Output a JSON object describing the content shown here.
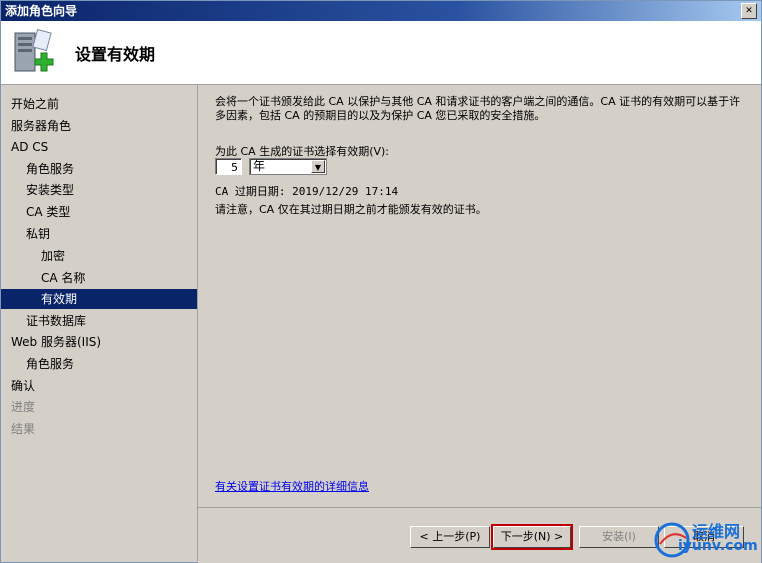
{
  "window": {
    "title": "添加角色向导"
  },
  "header": {
    "title": "设置有效期",
    "icon": "server-add-role-icon"
  },
  "sidebar": {
    "items": [
      {
        "label": "开始之前",
        "level": 1,
        "state": "normal"
      },
      {
        "label": "服务器角色",
        "level": 1,
        "state": "normal"
      },
      {
        "label": "AD CS",
        "level": 1,
        "state": "normal"
      },
      {
        "label": "角色服务",
        "level": 2,
        "state": "normal"
      },
      {
        "label": "安装类型",
        "level": 2,
        "state": "normal"
      },
      {
        "label": "CA 类型",
        "level": 2,
        "state": "normal"
      },
      {
        "label": "私钥",
        "level": 2,
        "state": "normal"
      },
      {
        "label": "加密",
        "level": 3,
        "state": "normal"
      },
      {
        "label": "CA 名称",
        "level": 3,
        "state": "normal"
      },
      {
        "label": "有效期",
        "level": 3,
        "state": "active"
      },
      {
        "label": "证书数据库",
        "level": 2,
        "state": "normal"
      },
      {
        "label": "Web 服务器(IIS)",
        "level": 1,
        "state": "normal"
      },
      {
        "label": "角色服务",
        "level": 2,
        "state": "normal"
      },
      {
        "label": "确认",
        "level": 1,
        "state": "normal"
      },
      {
        "label": "进度",
        "level": 1,
        "state": "disabled"
      },
      {
        "label": "结果",
        "level": 1,
        "state": "disabled"
      }
    ]
  },
  "main": {
    "description": "会将一个证书颁发给此 CA 以保护与其他 CA 和请求证书的客户端之间的通信。CA 证书的有效期可以基于许多因素，包括 CA 的预期目的以及为保护 CA 您已采取的安全措施。",
    "period_label": "为此 CA 生成的证书选择有效期(V):",
    "period_value": "5",
    "period_unit": "年",
    "expiry_text": "CA 过期日期: 2019/12/29 17:14",
    "note": "请注意，CA 仅在其过期日期之前才能颁发有效的证书。",
    "help_link": "有关设置证书有效期的详细信息"
  },
  "footer": {
    "prev_label": "< 上一步(P)",
    "next_label": "下一步(N) >",
    "install_label": "安装(I)",
    "cancel_label": "取消"
  },
  "watermark": {
    "text": "运维网",
    "url": "iyunv.com"
  },
  "colors": {
    "active_nav": "#0a246a",
    "title_bar": "#0a246a",
    "highlight": "#c00000",
    "link": "#0000ee"
  }
}
